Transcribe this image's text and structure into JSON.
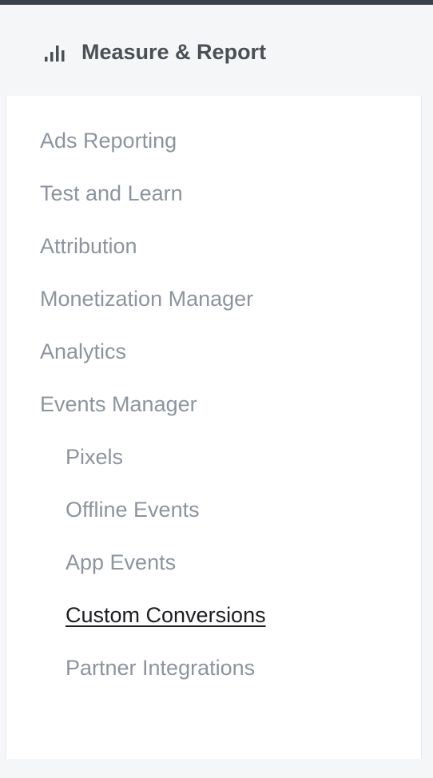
{
  "header": {
    "icon": "bar-chart-icon",
    "title": "Measure & Report"
  },
  "nav": {
    "items": [
      {
        "label": "Ads Reporting"
      },
      {
        "label": "Test and Learn"
      },
      {
        "label": "Attribution"
      },
      {
        "label": "Monetization Manager"
      },
      {
        "label": "Analytics"
      },
      {
        "label": "Events Manager"
      }
    ],
    "sub_items": [
      {
        "label": "Pixels"
      },
      {
        "label": "Offline Events"
      },
      {
        "label": "App Events"
      },
      {
        "label": "Custom Conversions",
        "active": true
      },
      {
        "label": "Partner Integrations"
      }
    ]
  },
  "colors": {
    "header_text": "#4b4f56",
    "item_text": "#8d949e",
    "active_text": "#1c1e21",
    "top_bar": "#3b4148"
  }
}
